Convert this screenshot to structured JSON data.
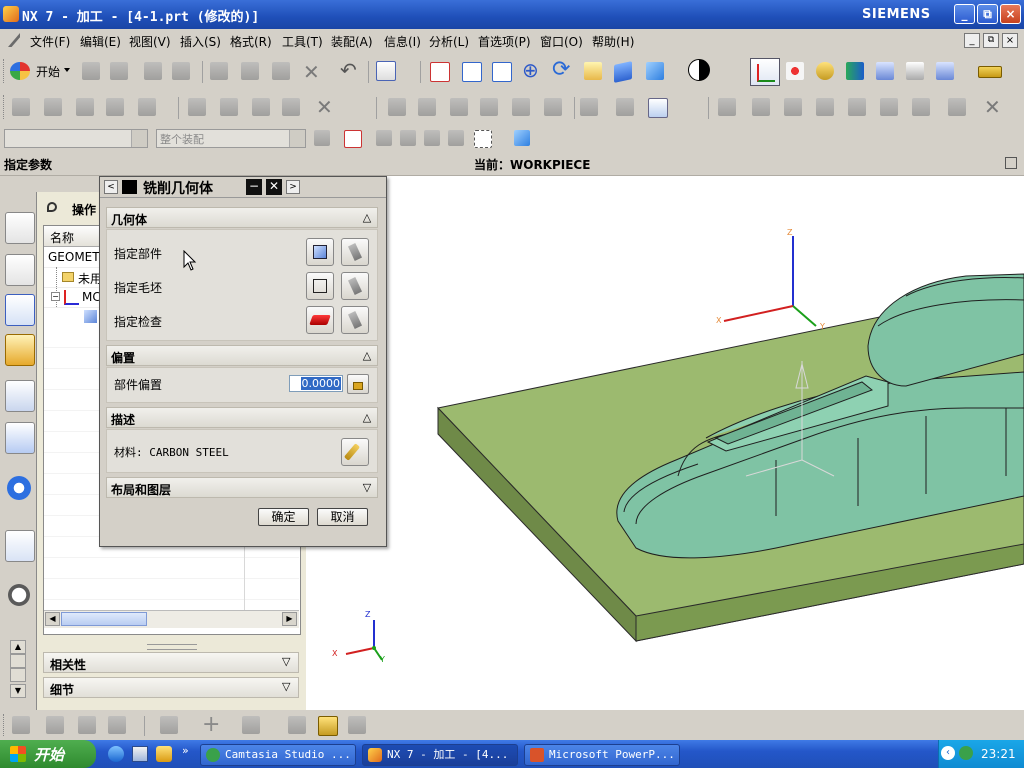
{
  "window": {
    "title": "NX 7 - 加工 - [4-1.prt (修改的)]",
    "brand": "SIEMENS",
    "controls": [
      "_",
      "⧉",
      "×"
    ]
  },
  "menu": {
    "items": [
      "文件(F)",
      "编辑(E)",
      "视图(V)",
      "插入(S)",
      "格式(R)",
      "工具(T)",
      "装配(A)",
      "信息(I)",
      "分析(L)",
      "首选项(P)",
      "窗口(O)",
      "帮助(H)"
    ]
  },
  "toolbar": {
    "start_label": "开始",
    "filter_placeholder": "",
    "selection_scope": "整个装配"
  },
  "status": {
    "prompt": "指定参数",
    "current_label": "当前：WORKPIECE"
  },
  "navigator": {
    "title": "操作",
    "column_name": "名称",
    "rows": [
      "GEOMETR",
      "未用",
      "MC"
    ],
    "section_dependencies": "相关性",
    "section_details": "细节"
  },
  "dialog": {
    "title": "铣削几何体",
    "geometry": {
      "header": "几何体",
      "rows": [
        "指定部件",
        "指定毛坯",
        "指定检查"
      ]
    },
    "offset": {
      "header": "偏置",
      "label": "部件偏置",
      "value": "0.0000"
    },
    "description": {
      "header": "描述",
      "material": "材料: CARBON STEEL"
    },
    "layout": {
      "header": "布局和图层"
    },
    "ok_label": "确定",
    "cancel_label": "取消"
  },
  "viewport": {
    "axis_labels": {
      "z": "Z",
      "x": "X",
      "y": "Y"
    }
  },
  "taskbar": {
    "start": "开始",
    "tasks": [
      "Camtasia Studio ...",
      "NX 7 - 加工 - [4...",
      "Microsoft PowerP..."
    ],
    "clock": "23:21"
  },
  "colors": {
    "title_bar": "#1f4fb8",
    "chrome": "#d4d0c8",
    "model_green": "#7fc3a4",
    "base_plate": "#9cb86f",
    "taskbar": "#2457c9"
  }
}
